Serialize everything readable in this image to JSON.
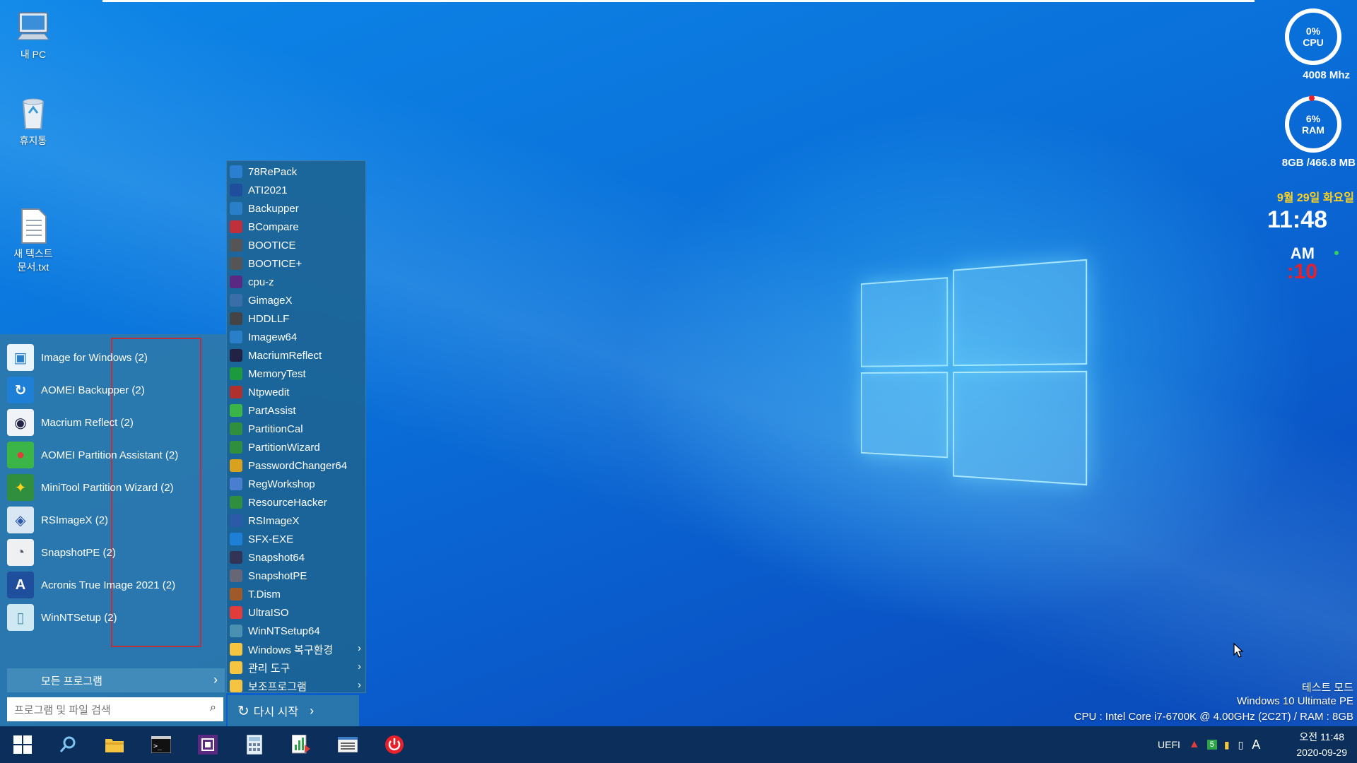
{
  "desktop": {
    "icons": [
      {
        "label": "내 PC",
        "icon": "computer-icon"
      },
      {
        "label": "휴지통",
        "icon": "recycle-bin-icon"
      },
      {
        "label": "새 텍스트\n문서.txt",
        "icon": "text-file-icon"
      }
    ]
  },
  "widgets": {
    "cpu": {
      "percent": "0%",
      "label": "CPU",
      "freq": "4008 Mhz",
      "usage_value": 0
    },
    "ram": {
      "percent": "6%",
      "label": "RAM",
      "info": "8GB /466.8 MB",
      "usage_value": 6
    },
    "date": "9월 29일 화요일",
    "time": "11:48",
    "ampm": "AM",
    "seconds": ":10",
    "colors": {
      "date": "#ffd21e",
      "seconds": "#e8202a",
      "ram_mark": "#e8202a"
    }
  },
  "start_menu": {
    "pinned": [
      {
        "label": "Image for Windows (2)",
        "icon": "image-for-windows-icon"
      },
      {
        "label": "AOMEI Backupper (2)",
        "icon": "aomei-backupper-icon"
      },
      {
        "label": "Macrium Reflect (2)",
        "icon": "macrium-reflect-icon"
      },
      {
        "label": "AOMEI Partition Assistant (2)",
        "icon": "partition-assistant-icon"
      },
      {
        "label": "MiniTool Partition Wizard (2)",
        "icon": "partition-wizard-icon"
      },
      {
        "label": "RSImageX (2)",
        "icon": "rsimagex-icon"
      },
      {
        "label": "SnapshotPE (2)",
        "icon": "snapshotpe-icon"
      },
      {
        "label": "Acronis True Image 2021 (2)",
        "icon": "acronis-icon"
      },
      {
        "label": "WinNTSetup (2)",
        "icon": "winntsetup-icon"
      }
    ],
    "all_programs": "모든 프로그램",
    "search_placeholder": "프로그램 및 파일 검색",
    "restart": "다시 시작"
  },
  "submenu": {
    "items": [
      {
        "label": "78RePack",
        "icon": "78repack-icon"
      },
      {
        "label": "ATI2021",
        "icon": "ati2021-icon"
      },
      {
        "label": "Backupper",
        "icon": "backupper-icon"
      },
      {
        "label": "BCompare",
        "icon": "bcompare-icon"
      },
      {
        "label": "BOOTICE",
        "icon": "bootice-icon"
      },
      {
        "label": "BOOTICE+",
        "icon": "bootice-plus-icon"
      },
      {
        "label": "cpu-z",
        "icon": "cpuz-icon"
      },
      {
        "label": "GimageX",
        "icon": "gimagex-icon"
      },
      {
        "label": "HDDLLF",
        "icon": "hddllf-icon"
      },
      {
        "label": "Imagew64",
        "icon": "imagew64-icon"
      },
      {
        "label": "MacriumReflect",
        "icon": "macriumreflect-icon"
      },
      {
        "label": "MemoryTest",
        "icon": "memorytest-icon"
      },
      {
        "label": "Ntpwedit",
        "icon": "ntpwedit-icon"
      },
      {
        "label": "PartAssist",
        "icon": "partassist-icon"
      },
      {
        "label": "PartitionCal",
        "icon": "partitioncal-icon"
      },
      {
        "label": "PartitionWizard",
        "icon": "partitionwizard-icon"
      },
      {
        "label": "PasswordChanger64",
        "icon": "passwordchanger-icon"
      },
      {
        "label": "RegWorkshop",
        "icon": "regworkshop-icon"
      },
      {
        "label": "ResourceHacker",
        "icon": "resourcehacker-icon"
      },
      {
        "label": "RSImageX",
        "icon": "rsimagex-small-icon"
      },
      {
        "label": "SFX-EXE",
        "icon": "sfx-exe-icon"
      },
      {
        "label": "Snapshot64",
        "icon": "snapshot64-icon"
      },
      {
        "label": "SnapshotPE",
        "icon": "snapshotpe-small-icon"
      },
      {
        "label": "T.Dism",
        "icon": "tdism-icon"
      },
      {
        "label": "UltraISO",
        "icon": "ultraiso-icon"
      },
      {
        "label": "WinNTSetup64",
        "icon": "winntsetup64-icon"
      },
      {
        "label": "Windows 복구환경",
        "icon": "folder-icon",
        "submenu": true
      },
      {
        "label": "관리 도구",
        "icon": "folder-icon",
        "submenu": true
      },
      {
        "label": "보조프로그램",
        "icon": "folder-icon",
        "submenu": true
      }
    ]
  },
  "info": {
    "mode": "테스트 모드",
    "os": "Windows 10 Ultimate PE",
    "hardware": "CPU : Intel Core i7-6700K @ 4.00GHz (2C2T) / RAM : 8GB"
  },
  "taskbar": {
    "buttons": [
      "start-icon",
      "search-icon",
      "file-explorer-icon",
      "command-prompt-icon",
      "cpuz-icon",
      "calculator-icon",
      "task-manager-icon",
      "list-icon",
      "power-icon"
    ],
    "tray": {
      "uefi": "UEFI",
      "badge": "5",
      "ime": "A"
    },
    "clock": {
      "time": "오전 11:48",
      "date": "2020-09-29"
    }
  }
}
